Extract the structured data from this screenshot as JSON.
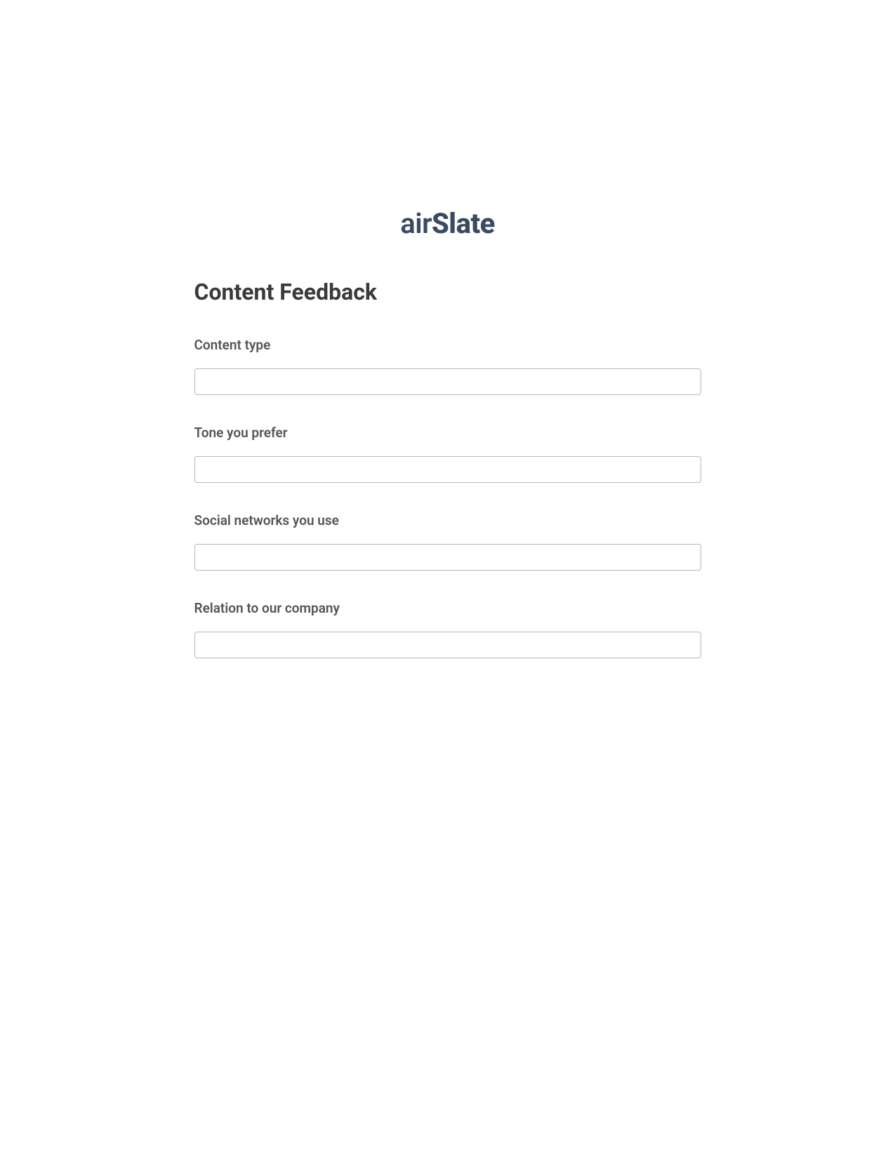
{
  "brand": {
    "name_prefix": "air",
    "name_suffix": "Slate",
    "color": "#3a4b61"
  },
  "form": {
    "title": "Content Feedback",
    "fields": [
      {
        "label": "Content type",
        "value": ""
      },
      {
        "label": "Tone you prefer",
        "value": ""
      },
      {
        "label": "Social networks you use",
        "value": ""
      },
      {
        "label": "Relation to our company",
        "value": ""
      }
    ]
  }
}
